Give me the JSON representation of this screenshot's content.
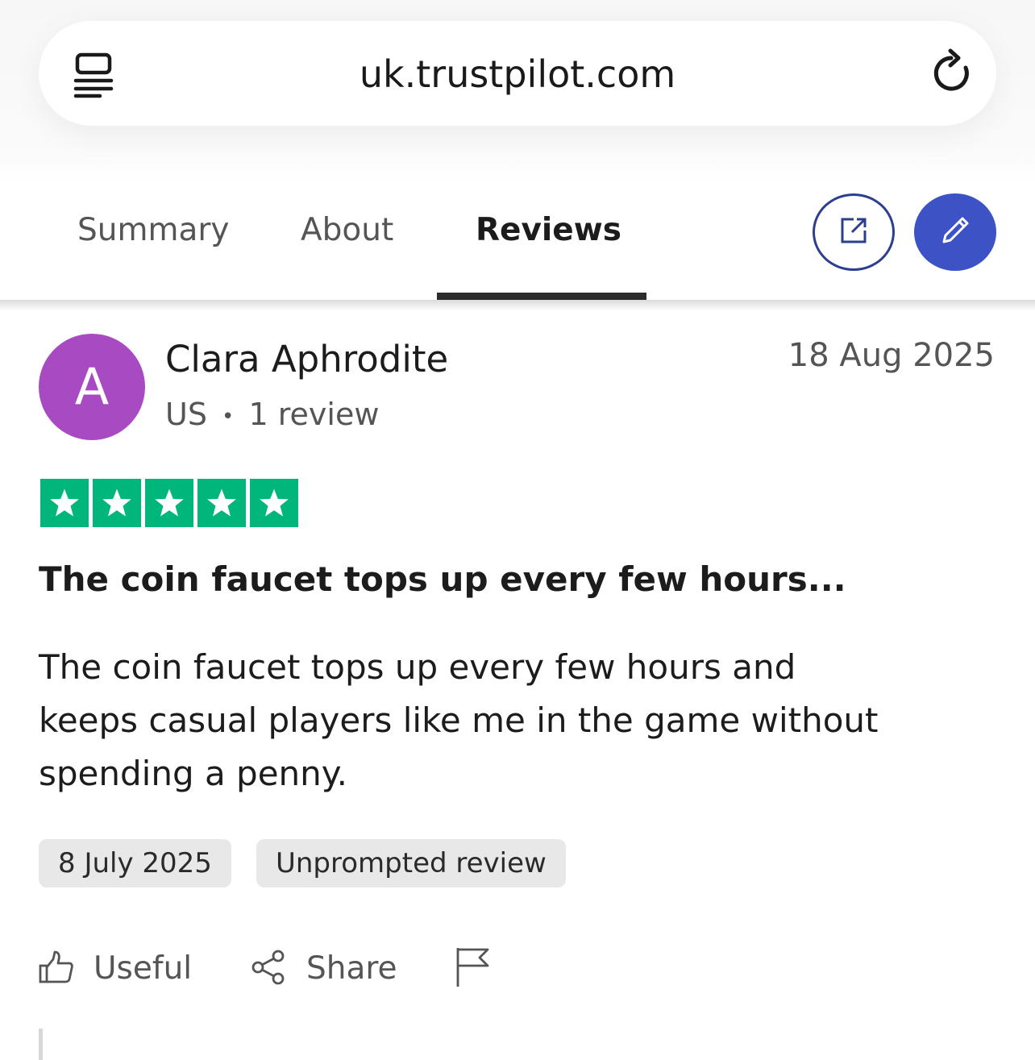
{
  "browser": {
    "url": "uk.trustpilot.com",
    "menu_icon": "tab-list-icon",
    "reload_icon": "reload-icon"
  },
  "tabs": [
    {
      "label": "Summary",
      "active": false
    },
    {
      "label": "About",
      "active": false
    },
    {
      "label": "Reviews",
      "active": true
    }
  ],
  "actions_top": {
    "visit_icon": "external-link-icon",
    "write_icon": "pencil-icon"
  },
  "review": {
    "avatar_letter": "A",
    "reviewer_name": "Clara Aphrodite",
    "country": "US",
    "separator": "•",
    "review_count": "1 review",
    "date_posted": "18 Aug 2025",
    "rating": 5,
    "max_rating": 5,
    "title": "The coin faucet tops up every few hours...",
    "body_lines": [
      "The coin faucet tops up every few hours and",
      "keeps casual players like me in the game without",
      "spending a penny."
    ],
    "experience_date": "8 July 2025",
    "review_type": "Unprompted review",
    "actions": {
      "useful": "Useful",
      "share": "Share"
    }
  },
  "colors": {
    "star_green": "#00b67a",
    "avatar_purple": "#a84bc3",
    "write_button_blue": "#3d52c4",
    "outline_button_navy": "#2c3f8f"
  }
}
